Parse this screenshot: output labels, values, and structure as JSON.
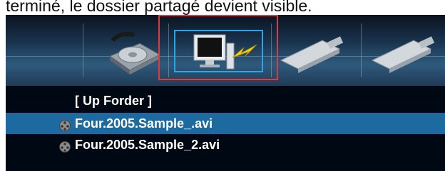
{
  "caption": "terminé, le dossier partagé devient visible.",
  "toolbar": {
    "items": [
      {
        "icon": "hard-drive-icon",
        "selected": false
      },
      {
        "icon": "network-monitor-icon",
        "selected": true
      },
      {
        "icon": "usb-drive-icon",
        "selected": false
      },
      {
        "icon": "usb-drive-icon",
        "selected": false
      }
    ]
  },
  "file_list": {
    "up_label": "[ Up Forder ]",
    "items": [
      {
        "name": "Four.2005.Sample_.avi",
        "icon": "film-reel-icon",
        "selected": true
      },
      {
        "name": "Four.2005.Sample_2.avi",
        "icon": "film-reel-icon",
        "selected": false
      }
    ]
  },
  "colors": {
    "selection": "#1d6aa0",
    "focus_frame": "#2aa6e8",
    "annotation_frame": "#e23a3a"
  }
}
